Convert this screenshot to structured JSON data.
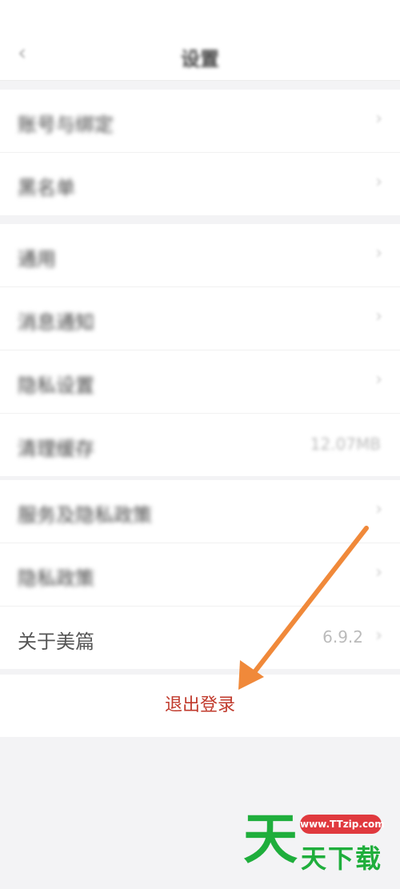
{
  "statusbar": {
    "left": "",
    "right": ""
  },
  "navbar": {
    "title": "设置"
  },
  "group1": [
    {
      "label": "账号与绑定"
    },
    {
      "label": "黑名单"
    }
  ],
  "group2": [
    {
      "label": "通用"
    },
    {
      "label": "消息通知"
    },
    {
      "label": "隐私设置"
    },
    {
      "label": "清理缓存",
      "value": "12.07MB"
    }
  ],
  "group3": [
    {
      "label": "服务及隐私政策"
    },
    {
      "label": "隐私政策"
    },
    {
      "label": "关于美篇",
      "value": "6.9.2"
    }
  ],
  "logout": {
    "label": "退出登录"
  },
  "watermark": {
    "big": "天",
    "url": "www.TTzip.com",
    "text": "天下载"
  },
  "colors": {
    "logout": "#c0392b",
    "arrow": "#f0893a",
    "watermark_green": "#1fae3c",
    "watermark_red": "#e0393e"
  }
}
